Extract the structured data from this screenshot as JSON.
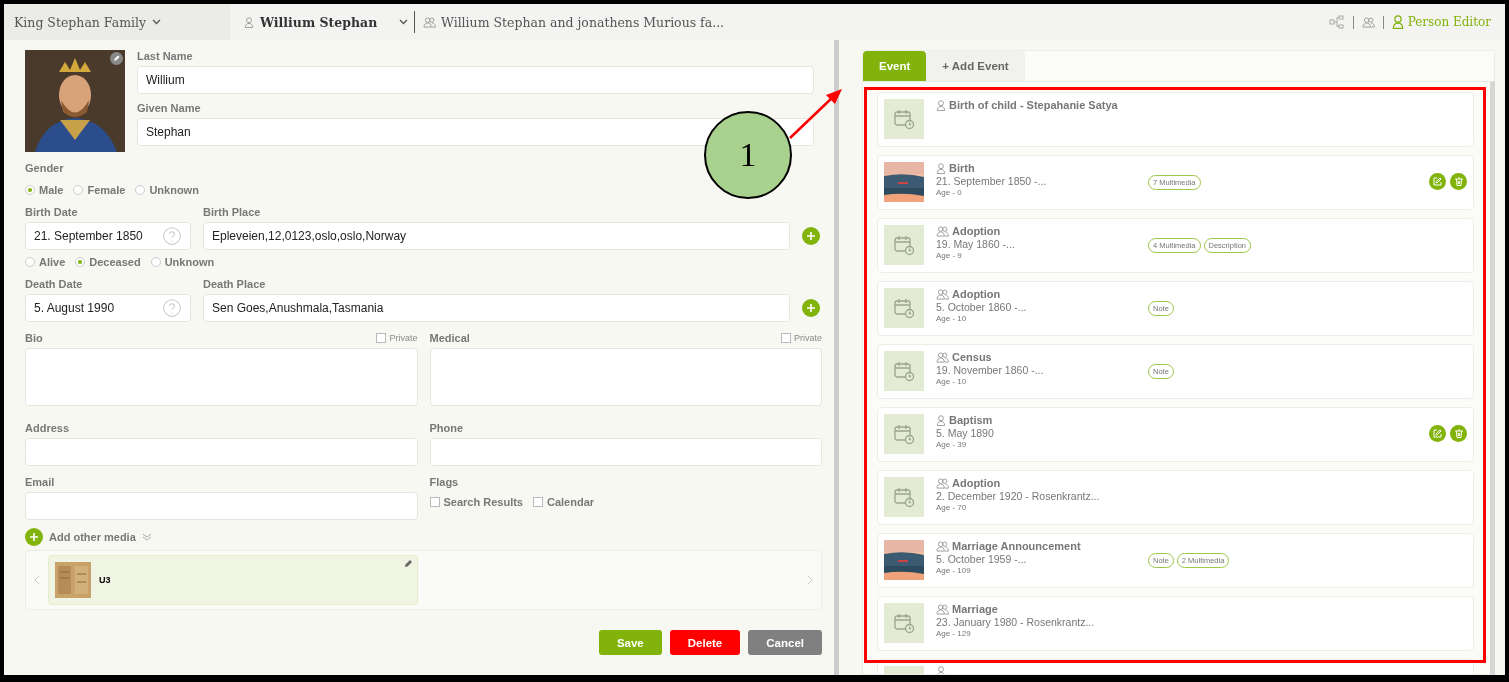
{
  "top_bar": {
    "family": "King Stephan Family",
    "person": "Willium Stephan",
    "relation": "Willium Stephan and jonathens Murious fa...",
    "editor": "Person Editor"
  },
  "form": {
    "last_name_label": "Last Name",
    "last_name": "Willium",
    "given_name_label": "Given Name",
    "given_name": "Stephan",
    "gender": {
      "label": "Gender",
      "options": [
        {
          "label": "Male",
          "selected": true
        },
        {
          "label": "Female",
          "selected": false
        },
        {
          "label": "Unknown",
          "selected": false
        }
      ]
    },
    "birth_date_label": "Birth Date",
    "birth_date": "21. September 1850",
    "birth_place_label": "Birth Place",
    "birth_place": "Epleveien,12,0123,oslo,oslo,Norway",
    "status": [
      {
        "label": "Alive",
        "selected": false
      },
      {
        "label": "Deceased",
        "selected": true
      },
      {
        "label": "Unknown",
        "selected": false
      }
    ],
    "death_date_label": "Death Date",
    "death_date": "5. August 1990",
    "death_place_label": "Death Place",
    "death_place": "Sen Goes,Anushmala,Tasmania",
    "bio_label": "Bio",
    "bio_private": {
      "label": "Private",
      "checked": false
    },
    "medical_label": "Medical",
    "medical_private": {
      "label": "Private",
      "checked": false
    },
    "address_label": "Address",
    "phone_label": "Phone",
    "email_label": "Email",
    "flags_label": "Flags",
    "flags": [
      {
        "label": "Search Results",
        "checked": false
      },
      {
        "label": "Calendar",
        "checked": false
      }
    ],
    "add_media": "Add other media",
    "media": [
      {
        "name": "U3"
      }
    ],
    "buttons": [
      {
        "label": "Save",
        "kind": "save"
      },
      {
        "label": "Delete",
        "kind": "delete"
      },
      {
        "label": "Cancel",
        "kind": "cancel"
      }
    ]
  },
  "tabs": [
    {
      "label": "Event",
      "selected": true
    },
    {
      "label": "+ Add Event",
      "selected": false
    }
  ],
  "events": [
    {
      "title": "Birth of child - Stepahanie Satya",
      "group": false,
      "kind": "calendar",
      "actions": false
    },
    {
      "title": "Birth",
      "date": "21. September 1850 -...",
      "age": "Age - 0",
      "group": false,
      "tags": [
        "7 Multimedia"
      ],
      "actions": true
    },
    {
      "title": "Adoption",
      "date": "19. May 1860 -...",
      "age": "Age - 9",
      "group": true,
      "kind": "calendar",
      "tags": [
        "4 Multimedia",
        "Description"
      ],
      "actions": false
    },
    {
      "title": "Adoption",
      "date": "5. October 1860 -...",
      "age": "Age - 10",
      "group": true,
      "kind": "calendar",
      "tags": [
        "Note"
      ],
      "actions": false
    },
    {
      "title": "Census",
      "date": "19. November 1860 -...",
      "age": "Age - 10",
      "group": true,
      "kind": "calendar",
      "tags": [
        "Note"
      ],
      "actions": false
    },
    {
      "title": "Baptism",
      "date": "5. May 1890",
      "age": "Age - 39",
      "group": false,
      "kind": "calendar",
      "actions": true
    },
    {
      "title": "Adoption",
      "date": "2. December 1920 - Rosenkrantz...",
      "age": "Age - 70",
      "group": true,
      "kind": "calendar",
      "actions": false
    },
    {
      "title": "Marriage Announcement",
      "date": "5. October 1959 -...",
      "age": "Age - 109",
      "group": true,
      "tags": [
        "Note",
        "2 Multimedia"
      ],
      "actions": false
    },
    {
      "title": "Marriage",
      "date": "23. January 1980 - Rosenkrantz...",
      "age": "Age - 129",
      "group": true,
      "kind": "calendar",
      "actions": false
    },
    {
      "group": false,
      "actions": false
    }
  ],
  "callout": {
    "label": "1"
  }
}
